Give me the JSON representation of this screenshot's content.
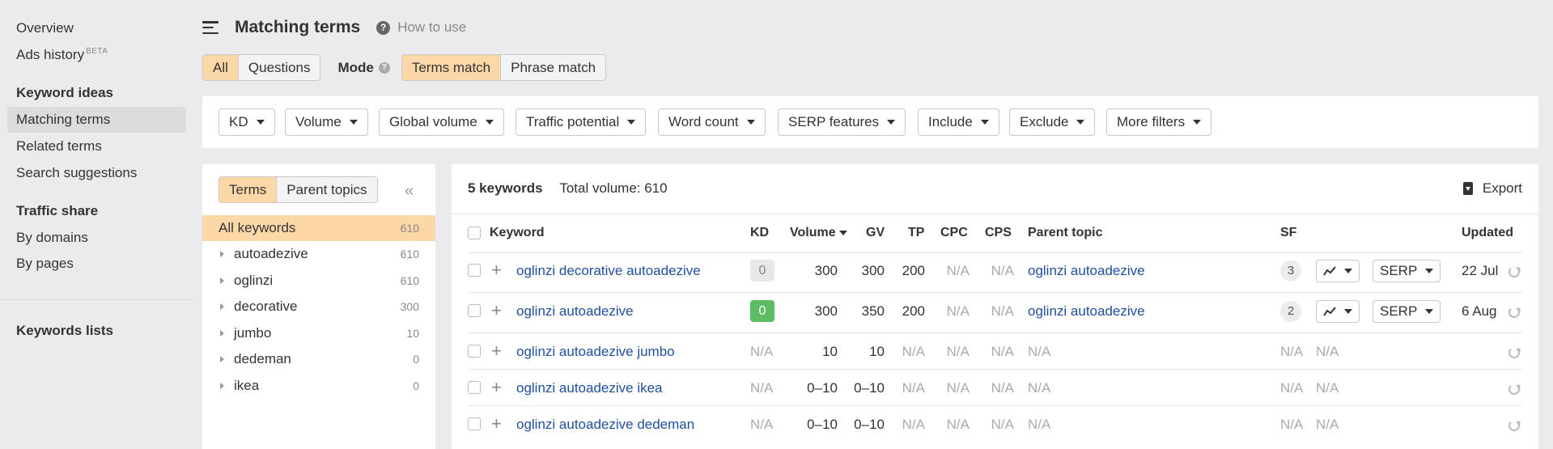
{
  "sidebar": {
    "overview": "Overview",
    "ads_history": "Ads history",
    "ads_history_badge": "BETA",
    "keyword_ideas_heading": "Keyword ideas",
    "matching_terms": "Matching terms",
    "related_terms": "Related terms",
    "search_suggestions": "Search suggestions",
    "traffic_share_heading": "Traffic share",
    "by_domains": "By domains",
    "by_pages": "By pages",
    "keywords_lists": "Keywords lists"
  },
  "header": {
    "title": "Matching terms",
    "how_to_use": "How to use",
    "help_glyph": "?"
  },
  "mode_row": {
    "all": "All",
    "questions": "Questions",
    "mode_label": "Mode",
    "terms_match": "Terms match",
    "phrase_match": "Phrase match"
  },
  "filters": [
    "KD",
    "Volume",
    "Global volume",
    "Traffic potential",
    "Word count",
    "SERP features",
    "Include",
    "Exclude",
    "More filters"
  ],
  "left_panel": {
    "tab_terms": "Terms",
    "tab_parent_topics": "Parent topics",
    "collapse_glyph": "«",
    "all_keywords": {
      "label": "All keywords",
      "count": "610"
    },
    "groups": [
      {
        "label": "autoadezive",
        "count": "610"
      },
      {
        "label": "oglinzi",
        "count": "610"
      },
      {
        "label": "decorative",
        "count": "300"
      },
      {
        "label": "jumbo",
        "count": "10"
      },
      {
        "label": "dedeman",
        "count": "0"
      },
      {
        "label": "ikea",
        "count": "0"
      }
    ]
  },
  "table": {
    "keyword_count": "5 keywords",
    "total_volume": "Total volume: 610",
    "export": "Export",
    "headers": {
      "keyword": "Keyword",
      "kd": "KD",
      "volume": "Volume",
      "gv": "GV",
      "tp": "TP",
      "cpc": "CPC",
      "cps": "CPS",
      "parent_topic": "Parent topic",
      "sf": "SF",
      "updated": "Updated"
    },
    "rows": [
      {
        "keyword": "oglinzi decorative autoadezive",
        "kd": "0",
        "volume": "300",
        "gv": "300",
        "tp": "200",
        "cpc": "N/A",
        "cps": "N/A",
        "parent_topic": "oglinzi autoadezive",
        "sf": "3",
        "serp": "SERP",
        "updated": "22 Jul"
      },
      {
        "keyword": "oglinzi autoadezive",
        "kd": "0",
        "volume": "300",
        "gv": "350",
        "tp": "200",
        "cpc": "N/A",
        "cps": "N/A",
        "parent_topic": "oglinzi autoadezive",
        "sf": "2",
        "serp": "SERP",
        "updated": "6 Aug"
      },
      {
        "keyword": "oglinzi autoadezive jumbo",
        "kd": "N/A",
        "volume": "10",
        "gv": "10",
        "tp": "N/A",
        "cpc": "N/A",
        "cps": "N/A",
        "parent_topic": "N/A",
        "sf": "N/A",
        "trend": "N/A",
        "updated": ""
      },
      {
        "keyword": "oglinzi autoadezive ikea",
        "kd": "N/A",
        "volume": "0–10",
        "gv": "0–10",
        "tp": "N/A",
        "cpc": "N/A",
        "cps": "N/A",
        "parent_topic": "N/A",
        "sf": "N/A",
        "trend": "N/A",
        "updated": ""
      },
      {
        "keyword": "oglinzi autoadezive dedeman",
        "kd": "N/A",
        "volume": "0–10",
        "gv": "0–10",
        "tp": "N/A",
        "cpc": "N/A",
        "cps": "N/A",
        "parent_topic": "N/A",
        "sf": "N/A",
        "trend": "N/A",
        "updated": ""
      }
    ]
  },
  "colors": {
    "accent_orange": "#fcd7a8",
    "link_blue": "#1f4f9e",
    "kd_green": "#5dbb63",
    "kd_gray": "#e8e8ea"
  }
}
